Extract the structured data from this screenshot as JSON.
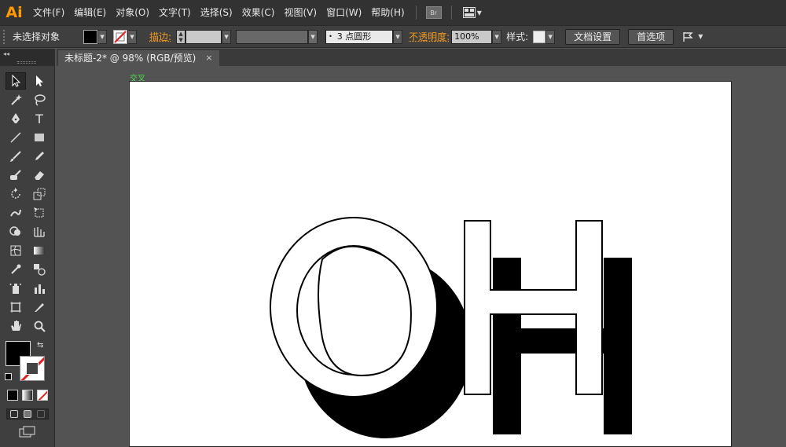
{
  "app": {
    "logo": "Ai"
  },
  "menu": [
    "文件(F)",
    "编辑(E)",
    "对象(O)",
    "文字(T)",
    "选择(S)",
    "效果(C)",
    "视图(V)",
    "窗口(W)",
    "帮助(H)"
  ],
  "menubar_extras": {
    "bridge": "Br"
  },
  "control_bar": {
    "selection_label": "未选择对象",
    "stroke_label": "描边:",
    "brush_value": "3 点圆形",
    "opacity_label": "不透明度:",
    "opacity_value": "100%",
    "style_label": "样式:",
    "doc_setup_button": "文档设置",
    "prefs_button": "首选项"
  },
  "document_tab": {
    "title": "未标题-2* @ 98% (RGB/预览)",
    "close": "×"
  },
  "canvas": {
    "smart_guide_label": "交叉",
    "artwork_text": "OH"
  },
  "colors": {
    "accent": "#ff9a00",
    "smart_guide": "#4ddd4d",
    "none_stroke": "#e02020"
  }
}
